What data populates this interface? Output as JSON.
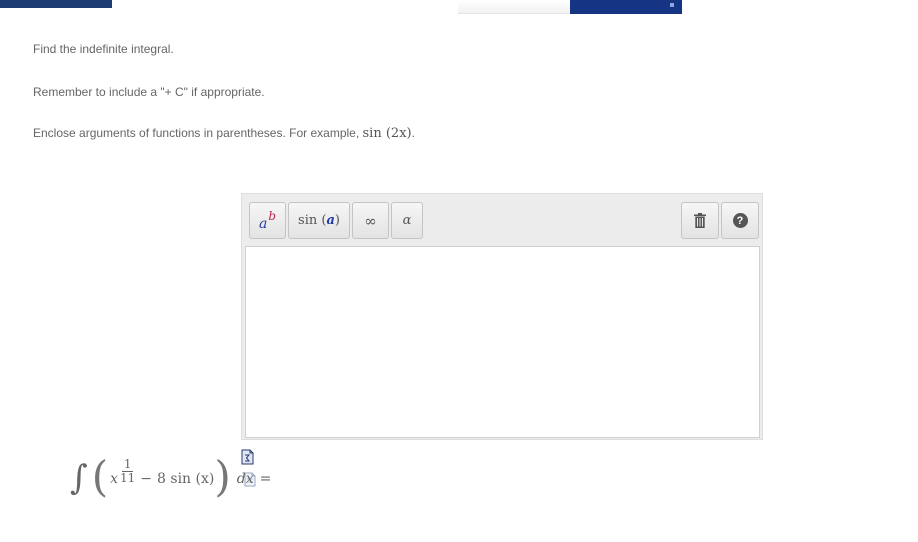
{
  "instructions": {
    "line1": "Find the indefinite integral.",
    "line2": "Remember to include a \"+ C\" if appropriate.",
    "line3_prefix": "Enclose arguments of functions in parentheses. For example, ",
    "line3_example_fn": "sin",
    "line3_example_arg": "(2x)",
    "line3_suffix": "."
  },
  "toolbar": {
    "exponent_base": "a",
    "exponent_power": "b",
    "function_name": "sin",
    "function_open": "(",
    "function_arg": "a",
    "function_close": ")",
    "infinity_label": "∞",
    "greek_label": "α",
    "help_label": "?"
  },
  "answer": {
    "value": ""
  },
  "problem": {
    "integral": "∫",
    "open_paren": "(",
    "x": "x",
    "exp_numerator": "1",
    "exp_denominator": "11",
    "minus": "−",
    "term": "8 sin (x)",
    "close_paren": ")",
    "dx": "dx",
    "equals": "="
  },
  "colors": {
    "top_bar": "#1d3c74",
    "top_box": "#153584",
    "text": "#666666",
    "toolbar_bg": "#ececec"
  },
  "icons": {
    "trash": "trash-icon",
    "help": "help-icon",
    "doc": "document-icon"
  }
}
